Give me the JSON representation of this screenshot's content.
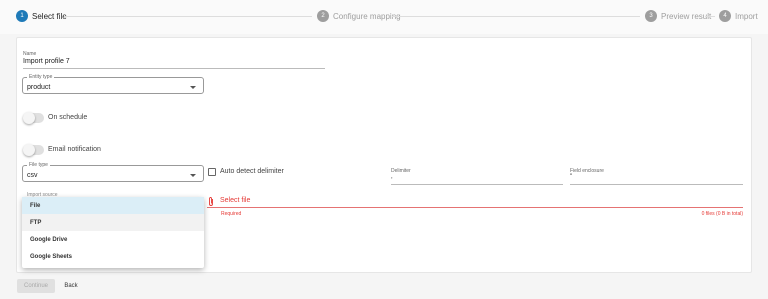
{
  "stepper": {
    "steps": [
      {
        "number": "1",
        "label": "Select file",
        "state": "active"
      },
      {
        "number": "2",
        "label": "Configure mapping",
        "state": "inactive"
      },
      {
        "number": "3",
        "label": "Preview result",
        "state": "inactive"
      },
      {
        "number": "4",
        "label": "Import",
        "state": "inactive"
      }
    ]
  },
  "form": {
    "name": {
      "label": "Name",
      "value": "Import profile 7"
    },
    "entity_type": {
      "label": "Entity type",
      "value": "product"
    },
    "on_schedule": {
      "label": "On schedule",
      "checked": false
    },
    "email_notification": {
      "label": "Email notification",
      "checked": false
    },
    "file_type": {
      "label": "File type",
      "value": "csv"
    },
    "auto_detect": {
      "label": "Auto detect delimiter",
      "checked": false
    },
    "delimiter": {
      "label": "Delimiter",
      "value": ","
    },
    "field_enclosure": {
      "label": "Field enclosure",
      "value": "\""
    },
    "import_source": {
      "label": "Import source",
      "value": "File"
    },
    "select_file": {
      "label": "Select file",
      "error": "Required",
      "files_count": "0 files (0 B in total)"
    }
  },
  "menu": {
    "items": [
      "File",
      "FTP",
      "Google Drive",
      "Google Sheets"
    ],
    "selected_index": 0,
    "hover_index": 1
  },
  "actions": {
    "continue_label": "Continue",
    "back_label": "Back"
  },
  "colors": {
    "accent": "#1f7ab8",
    "error": "#e53935",
    "menu_selected": "#dbeef7"
  }
}
